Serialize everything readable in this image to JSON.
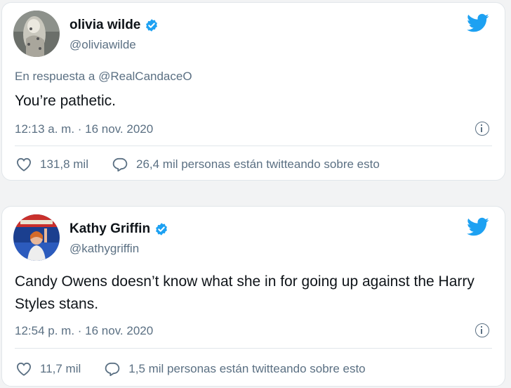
{
  "tweets": [
    {
      "name": "olivia wilde",
      "handle": "@oliviawilde",
      "reply_to": "En respuesta a @RealCandaceO",
      "text": "You’re pathetic.",
      "timestamp": "12:13 a. m. · 16 nov. 2020",
      "likes": "131,8 mil",
      "conversation": "26,4 mil personas están twitteando sobre esto"
    },
    {
      "name": "Kathy Griffin",
      "handle": "@kathygriffin",
      "text": "Candy Owens doesn’t know what she in for going up against the Harry Styles stans.",
      "timestamp": "12:54 p. m. · 16 nov. 2020",
      "likes": "11,7 mil",
      "conversation": "1,5 mil personas están twitteando sobre esto"
    }
  ],
  "colors": {
    "twitter_blue": "#1da1f2",
    "secondary_text": "#5b7083",
    "primary_text": "#0f1419",
    "border": "#e1e6ea"
  },
  "icons": [
    "verified-badge-icon",
    "twitter-bird-icon",
    "info-icon",
    "heart-icon",
    "reply-bubble-icon"
  ]
}
